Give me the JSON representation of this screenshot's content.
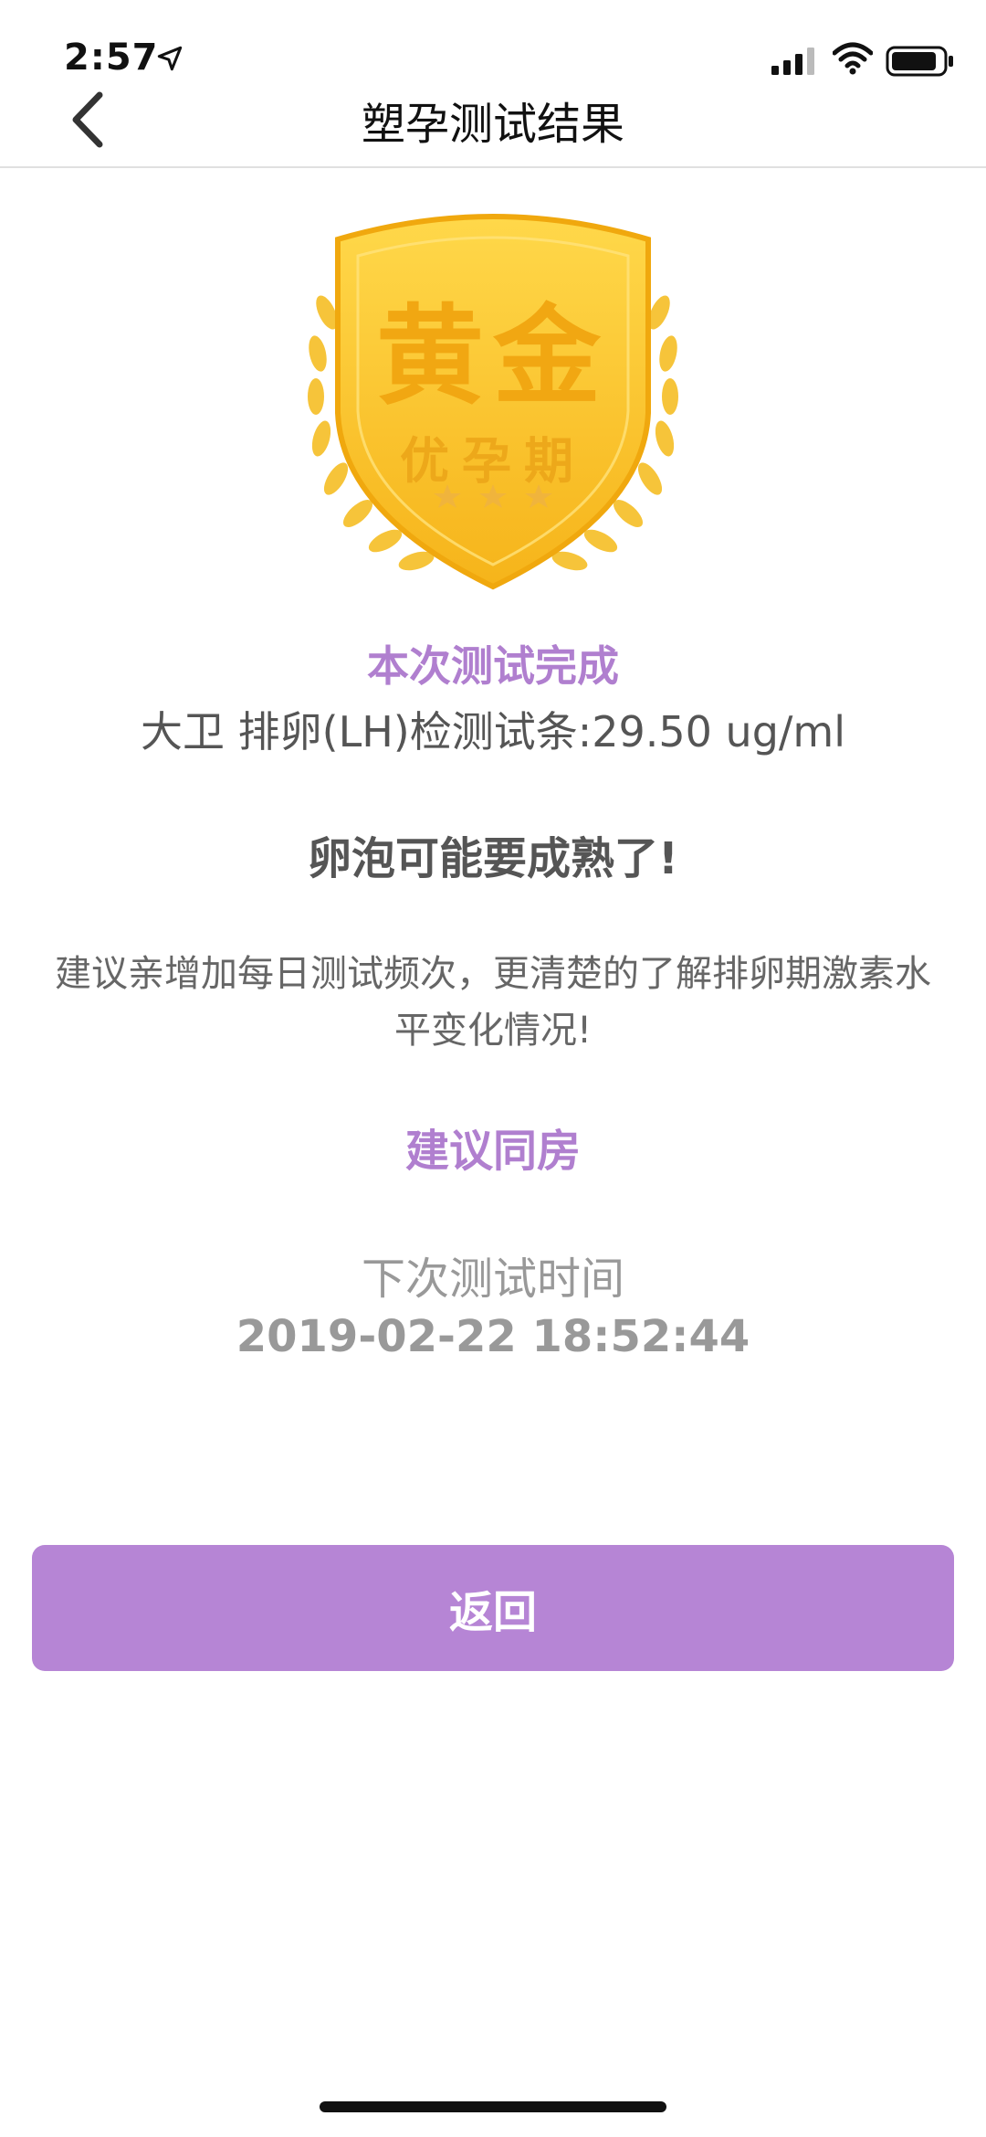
{
  "status_bar": {
    "time": "2:57"
  },
  "nav": {
    "title": "塑孕测试结果"
  },
  "badge": {
    "main": "黄金",
    "sub": "优孕期",
    "stars": 3
  },
  "result": {
    "complete_label": "本次测试完成",
    "measurement": "大卫 排卵(LH)检测试条:29.50 ug/ml",
    "status_message": "卵泡可能要成熟了!",
    "advice": "建议亲增加每日测试频次，更清楚的了解排卵期激素水平变化情况!",
    "suggestion": "建议同房",
    "next_test_label": "下次测试时间",
    "next_test_time": "2019-02-22 18:52:44"
  },
  "buttons": {
    "return_label": "返回"
  },
  "colors": {
    "accent": "#b685d5",
    "gold": "#f5b51a"
  }
}
